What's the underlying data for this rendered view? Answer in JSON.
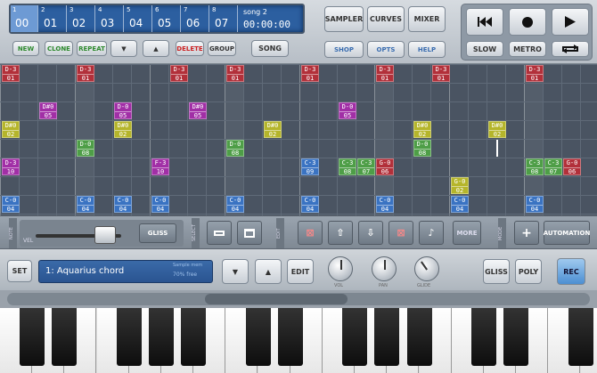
{
  "lcd": {
    "patterns": [
      {
        "num": "1",
        "val": "00"
      },
      {
        "num": "2",
        "val": "01"
      },
      {
        "num": "3",
        "val": "02"
      },
      {
        "num": "4",
        "val": "03"
      },
      {
        "num": "5",
        "val": "04"
      },
      {
        "num": "6",
        "val": "05"
      },
      {
        "num": "7",
        "val": "06"
      },
      {
        "num": "8",
        "val": "07"
      }
    ],
    "song": "song 2",
    "time": "00:00:00"
  },
  "top_buttons": {
    "new": "NEW",
    "clone": "CLONE",
    "repeat": "REPEAT",
    "down": "▼",
    "up": "▲",
    "delete": "DELETE",
    "group": "GROUP",
    "song": "SONG",
    "sampler": "SAMPLER",
    "curves": "CURVES",
    "mixer": "MIXER",
    "shop": "SHOP",
    "opts": "OPTS",
    "help": "HELP"
  },
  "transport": {
    "slow": "SLOW",
    "metro": "METRO"
  },
  "notes": [
    {
      "t": "D-3",
      "b": "01",
      "color": "red"
    },
    {
      "t": "D-3",
      "b": "01",
      "color": "red"
    },
    {
      "t": "D-3",
      "b": "01",
      "color": "red"
    },
    {
      "t": "D-3",
      "b": "01",
      "color": "red"
    },
    {
      "t": "D-3",
      "b": "01",
      "color": "red"
    },
    {
      "t": "D-3",
      "b": "01",
      "color": "red"
    },
    {
      "t": "D-3",
      "b": "01",
      "color": "red"
    },
    {
      "t": "D#0",
      "b": "05",
      "color": "purple"
    },
    {
      "t": "D-0",
      "b": "05",
      "color": "purple"
    },
    {
      "t": "D#0",
      "b": "05",
      "color": "purple"
    },
    {
      "t": "D-0",
      "b": "05",
      "color": "purple"
    },
    {
      "t": "D#0",
      "b": "02",
      "color": "yellow"
    },
    {
      "t": "D#0",
      "b": "02",
      "color": "yellow"
    },
    {
      "t": "D#0",
      "b": "02",
      "color": "yellow"
    },
    {
      "t": "D#0",
      "b": "02",
      "color": "yellow"
    },
    {
      "t": "D#0",
      "b": "02",
      "color": "yellow"
    },
    {
      "t": "D-0",
      "b": "08",
      "color": "green"
    },
    {
      "t": "D-0",
      "b": "08",
      "color": "green"
    },
    {
      "t": "D-0",
      "b": "08",
      "color": "green"
    },
    {
      "t": "D-3",
      "b": "10",
      "color": "purple"
    },
    {
      "t": "F-3",
      "b": "10",
      "color": "purple"
    },
    {
      "t": "C-3",
      "b": "09",
      "color": "blue"
    },
    {
      "t": "C-3",
      "b": "08",
      "color": "green"
    },
    {
      "t": "C-3",
      "b": "07",
      "color": "green"
    },
    {
      "t": "G-0",
      "b": "06",
      "color": "red"
    },
    {
      "t": "C-3",
      "b": "08",
      "color": "green"
    },
    {
      "t": "C-3",
      "b": "07",
      "color": "green"
    },
    {
      "t": "G-0",
      "b": "06",
      "color": "red"
    },
    {
      "t": "G-0",
      "b": "02",
      "color": "yellow"
    },
    {
      "t": "C-0",
      "b": "04",
      "color": "blue"
    },
    {
      "t": "C-0",
      "b": "04",
      "color": "blue"
    },
    {
      "t": "C-0",
      "b": "04",
      "color": "blue"
    },
    {
      "t": "C-0",
      "b": "04",
      "color": "blue"
    },
    {
      "t": "C-0",
      "b": "04",
      "color": "blue"
    },
    {
      "t": "C-0",
      "b": "04",
      "color": "blue"
    },
    {
      "t": "C-0",
      "b": "04",
      "color": "blue"
    },
    {
      "t": "C-0",
      "b": "04",
      "color": "blue"
    },
    {
      "t": "C-0",
      "b": "04",
      "color": "blue"
    }
  ],
  "note_colors": {
    "red": "#b2303a",
    "purple": "#a12fa6",
    "yellow": "#b5b52b",
    "green": "#4e9e47",
    "blue": "#3a73c2"
  },
  "toolbar": {
    "note_label": "NOTE",
    "vel_label": "VEL",
    "gliss": "GLISS",
    "select_label": "SELECT",
    "edit_label": "EDIT",
    "more": "MORE",
    "mode_label": "MODE",
    "plus": "+",
    "automation": "AUTOMATION"
  },
  "instrument": {
    "set": "SET",
    "name": "1: Aquarius chord",
    "info1": "Sample mem",
    "info2": "70% free",
    "down": "▼",
    "up": "▲",
    "edit": "EDIT",
    "knobs": [
      "VOL",
      "PAN",
      "GLIDE"
    ],
    "gliss": "GLISS",
    "poly": "POLY",
    "rec": "REC"
  }
}
